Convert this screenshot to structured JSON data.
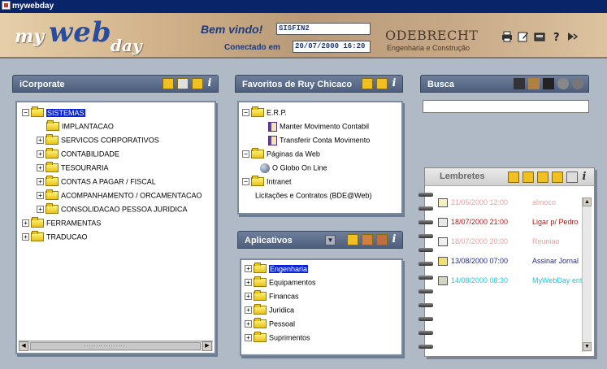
{
  "window": {
    "title": "mywebday"
  },
  "header": {
    "logo": {
      "my": "my",
      "web": "web",
      "day": "day"
    },
    "welcome_label": "Bem vindo!",
    "user": "SISFIN2",
    "connected_label": "Conectado em",
    "connected_at": "20/07/2000 16:20",
    "company": "ODEBRECHT",
    "company_sub": "Engenharia e Construção",
    "icons": [
      "printer-icon",
      "edit-icon",
      "tools-icon",
      "help-icon",
      "exit-icon"
    ]
  },
  "icorporate": {
    "title": "iCorporate",
    "tree": [
      {
        "label": "SISTEMAS",
        "level": 0,
        "expander": "−",
        "selected": true
      },
      {
        "label": "IMPLANTACAO",
        "level": 1,
        "expander": ""
      },
      {
        "label": "SERVICOS CORPORATIVOS",
        "level": 1,
        "expander": "+"
      },
      {
        "label": "CONTABILIDADE",
        "level": 1,
        "expander": "+"
      },
      {
        "label": "TESOURARIA",
        "level": 1,
        "expander": "+"
      },
      {
        "label": "CONTAS A PAGAR / FISCAL",
        "level": 1,
        "expander": "+"
      },
      {
        "label": "ACOMPANHAMENTO / ORCAMENTACAO",
        "level": 1,
        "expander": "+"
      },
      {
        "label": "CONSOLIDACAO PESSOA JURIDICA",
        "level": 1,
        "expander": "+"
      },
      {
        "label": "FERRAMENTAS",
        "level": 0,
        "expander": "+"
      },
      {
        "label": "TRADUCAO",
        "level": 0,
        "expander": "+"
      }
    ]
  },
  "favoritos": {
    "title": "Favoritos de Ruy Chicaco",
    "tree": [
      {
        "label": "E.R.P.",
        "kind": "folder",
        "expander": "−"
      },
      {
        "label": "Manter Movimento Contabil",
        "kind": "book"
      },
      {
        "label": "Transferir Conta Movimento",
        "kind": "book"
      },
      {
        "label": "Páginas da Web",
        "kind": "folder",
        "expander": "−"
      },
      {
        "label": "O Globo On Line",
        "kind": "globe"
      },
      {
        "label": "Intranet",
        "kind": "folder",
        "expander": "−"
      },
      {
        "label": "Licitações e Contratos (BDE@Web)",
        "kind": "text"
      }
    ]
  },
  "aplicativos": {
    "title": "Aplicativos",
    "tree": [
      {
        "label": "Engenharia",
        "selected": true
      },
      {
        "label": "Equipamentos"
      },
      {
        "label": "Financas"
      },
      {
        "label": "Juridica"
      },
      {
        "label": "Pessoal"
      },
      {
        "label": "Suprimentos"
      }
    ]
  },
  "busca": {
    "title": "Busca",
    "value": ""
  },
  "lembretes": {
    "title": "Lembretes",
    "items": [
      {
        "datetime": "21/05/2000 12:00",
        "text": "almoco",
        "color": "#e8a0a0",
        "icon": "mail-icon"
      },
      {
        "datetime": "18/07/2000 21:00",
        "text": "Ligar p/ Pedro",
        "color": "#c01010",
        "icon": "contact-card-icon"
      },
      {
        "datetime": "18/07/2000 20:00",
        "text": "Reuniao",
        "color": "#e8a0a0",
        "icon": "meeting-icon"
      },
      {
        "datetime": "13/08/2000 07:00",
        "text": "Assinar Jornal",
        "color": "#1e2a8a",
        "icon": "note-icon"
      },
      {
        "datetime": "14/08/2000 08:30",
        "text": "MyWebDay entra",
        "color": "#20c8d8",
        "icon": "phone-icon"
      }
    ]
  },
  "colors": {
    "panel_head": "#5a6c8a",
    "selection": "#0a24d8",
    "accent_blue": "#2a4c9c"
  }
}
